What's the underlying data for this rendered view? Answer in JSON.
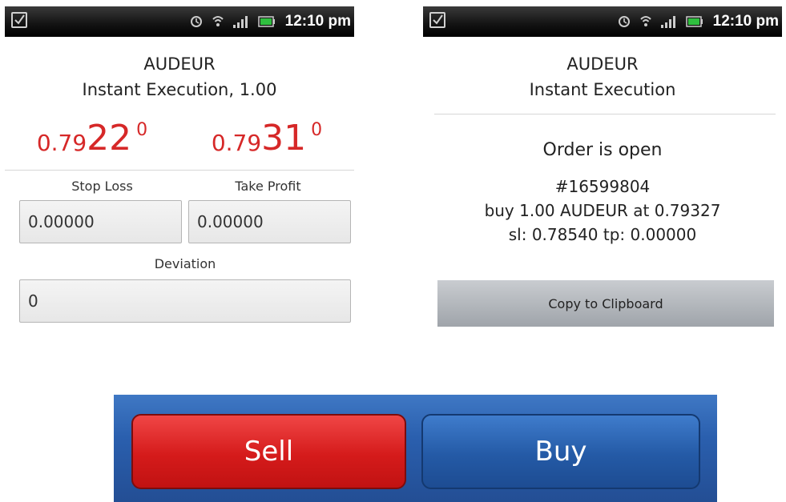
{
  "status_bar": {
    "time": "12:10 pm"
  },
  "left_screen": {
    "symbol": "AUDEUR",
    "mode": "Instant Execution, 1.00",
    "bid": {
      "prefix": "0.79",
      "big": "22",
      "sup": "0"
    },
    "ask": {
      "prefix": "0.79",
      "big": "31",
      "sup": "0"
    },
    "stop_loss_label": "Stop Loss",
    "take_profit_label": "Take Profit",
    "stop_loss_value": "0.00000",
    "take_profit_value": "0.00000",
    "deviation_label": "Deviation",
    "deviation_value": "0"
  },
  "right_screen": {
    "symbol": "AUDEUR",
    "mode": "Instant Execution",
    "status": "Order is open",
    "ticket": "#16599804",
    "order_line": "buy 1.00 AUDEUR at 0.79327",
    "sltp_line": "sl: 0.78540 tp: 0.00000",
    "copy_label": "Copy to Clipboard"
  },
  "actions": {
    "sell_label": "Sell",
    "buy_label": "Buy"
  },
  "colors": {
    "price_red": "#d62828",
    "sell_red": "#d51b1b",
    "buy_blue": "#245aa6"
  }
}
